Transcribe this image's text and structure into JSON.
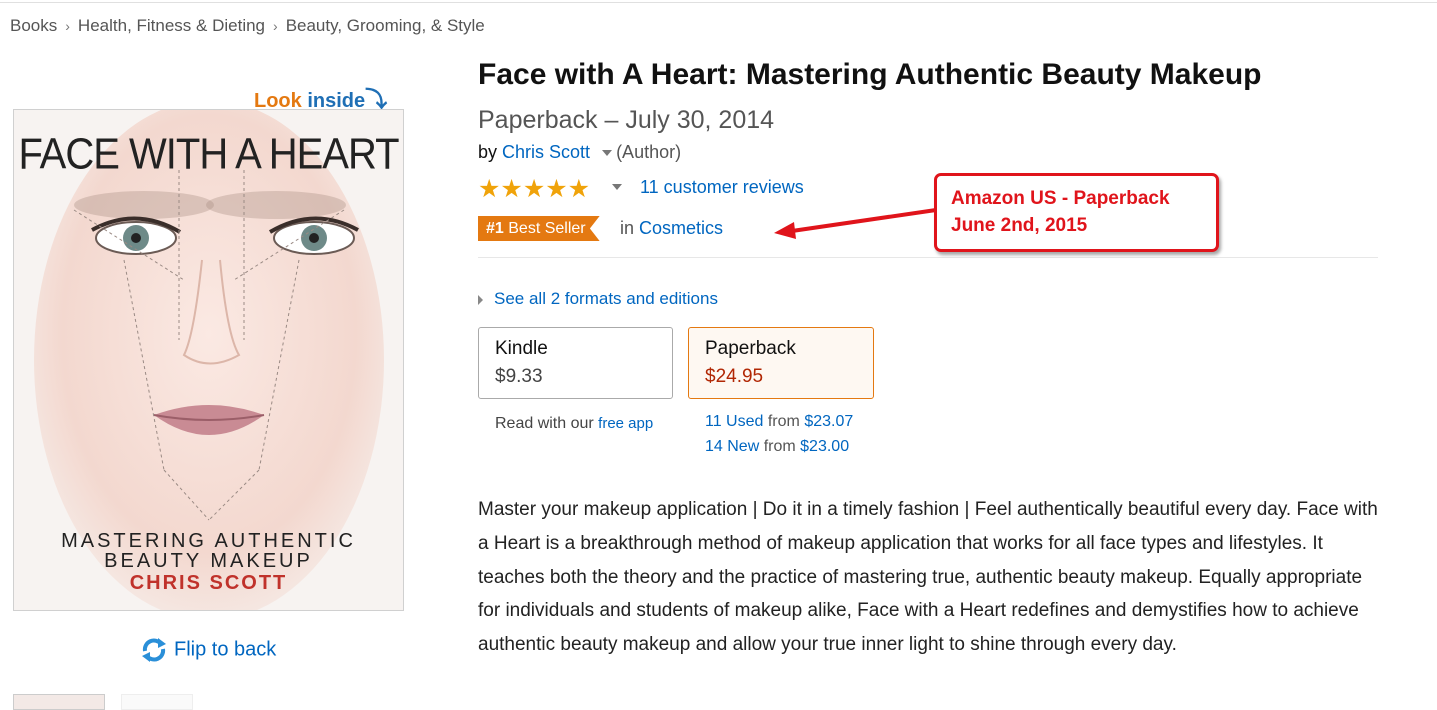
{
  "breadcrumb": [
    "Books",
    "Health, Fitness & Dieting",
    "Beauty, Grooming, & Style"
  ],
  "breadcrumb_separator": "›",
  "look_inside": {
    "part1": "Look",
    "part2": "inside",
    "arrow": "⤵"
  },
  "cover": {
    "title": "FACE WITH A HEART",
    "subtitle_line1": "MASTERING AUTHENTIC",
    "subtitle_line2": "BEAUTY MAKEUP",
    "author": "CHRIS SCOTT"
  },
  "flip_label": "Flip to back",
  "product": {
    "title": "Face with A Heart: Mastering Authentic Beauty Makeup",
    "format_date": "Paperback – July 30, 2014",
    "by": "by",
    "author": "Chris Scott",
    "author_role": "(Author)",
    "stars": "★★★★★",
    "rating": 5,
    "reviews": "11 customer reviews",
    "badge_rank": "#1",
    "badge_text": "Best Seller",
    "badge_in": "in",
    "badge_category": "Cosmetics",
    "see_all": "See all 2 formats and editions"
  },
  "formats": [
    {
      "name": "Kindle",
      "price": "$9.33",
      "selected": false
    },
    {
      "name": "Paperback",
      "price": "$24.95",
      "selected": true
    }
  ],
  "kindle_note": {
    "text": "Read with our",
    "link": "free app"
  },
  "offers": [
    {
      "label": "11 Used",
      "from": "from",
      "price": "$23.07"
    },
    {
      "label": "14 New",
      "from": "from",
      "price": "$23.00"
    }
  ],
  "description": "Master your makeup application | Do it in a timely fashion | Feel authentically beautiful every day. Face with a Heart is a breakthrough method of makeup application that works for all face types and lifestyles. It teaches both the theory and the practice of mastering true, authentic beauty makeup. Equally appropriate for individuals and students of makeup alike, Face with a Heart redefines and demystifies how to achieve authentic beauty makeup and allow your true inner light to shine through every day.",
  "annotation": {
    "line1": "Amazon US - Paperback",
    "line2": "June 2nd, 2015"
  },
  "colors": {
    "link": "#0066c0",
    "badge": "#e47911",
    "price": "#b12704",
    "annotation": "#e0141b",
    "star": "#f0a30a"
  }
}
